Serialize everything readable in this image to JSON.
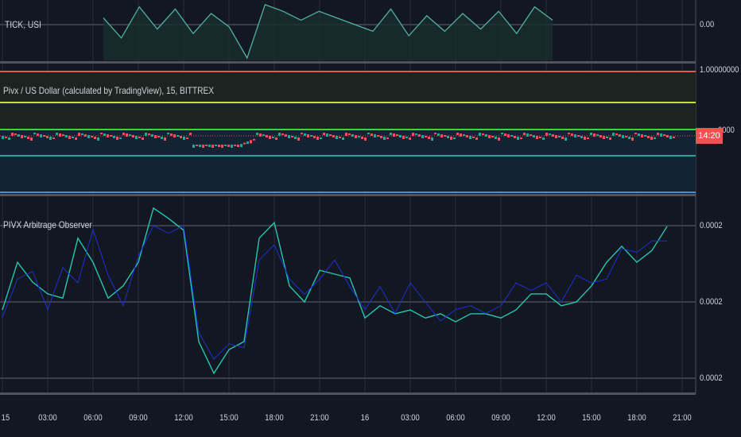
{
  "colors": {
    "background": "#131722",
    "grid": "#2a2e39",
    "cyan": "#26c6b0",
    "blue": "#1e2fd6",
    "red": "#ef5350",
    "yellowgreen": "#c6e03a",
    "green": "#3fd13f",
    "teal": "#26a69a",
    "lightblue": "#3d8fd6"
  },
  "panels": {
    "tick": {
      "title": "TICK, USI",
      "axis_label": "0.00"
    },
    "price": {
      "title": "Pivx / US Dollar (calculated by TradingView), 15, BITTREX",
      "axis_top": "1.00000000",
      "axis_mid": "0000",
      "badge": "14:20"
    },
    "observer": {
      "title": "PIVX Arbitrage Observer",
      "axis_labels": [
        "0.0002",
        "0.0002",
        "0.0002"
      ]
    }
  },
  "time_axis": [
    "15",
    "03:00",
    "06:00",
    "09:00",
    "12:00",
    "15:00",
    "18:00",
    "21:00",
    "16",
    "03:00",
    "06:00",
    "09:00",
    "12:00",
    "15:00",
    "18:00",
    "21:00"
  ],
  "chart_data": [
    {
      "type": "area",
      "title": "TICK, USI",
      "y_ticks": [
        "0.00"
      ],
      "values": [
        0.3,
        -0.6,
        0.8,
        -0.2,
        0.7,
        -0.4,
        0.5,
        -0.1,
        -1.5,
        0.9,
        0.6,
        0.2,
        0.6,
        0.3,
        0.0,
        -0.3,
        0.7,
        -0.5,
        0.4,
        -0.3,
        0.5,
        -0.2,
        0.6,
        -0.4,
        0.8,
        0.2
      ]
    },
    {
      "type": "line",
      "title": "PIVX Arbitrage Observer",
      "y_ticks": [
        "0.0002",
        "0.0002",
        "0.0002"
      ],
      "x": [
        "15 00:00",
        "15 01:00",
        "15 02:00",
        "15 03:00",
        "15 04:00",
        "15 05:00",
        "15 06:00",
        "15 07:00",
        "15 08:00",
        "15 09:00",
        "15 10:00",
        "15 11:00",
        "15 12:00",
        "15 13:00",
        "15 14:00",
        "15 15:00",
        "15 16:00",
        "15 17:00",
        "15 18:00",
        "15 19:00",
        "15 20:00",
        "15 21:00",
        "15 22:00",
        "15 23:00",
        "16 00:00",
        "16 01:00",
        "16 02:00",
        "16 03:00",
        "16 04:00",
        "16 05:00",
        "16 06:00",
        "16 07:00",
        "16 08:00",
        "16 09:00",
        "16 10:00",
        "16 11:00",
        "16 12:00",
        "16 13:00",
        "16 14:00",
        "16 15:00",
        "16 16:00",
        "16 17:00",
        "16 18:00",
        "16 19:00",
        "16 20:00"
      ],
      "series": [
        {
          "color": "#26c6b0",
          "values": [
            0.0002179,
            0.0002304,
            0.0002252,
            0.0002221,
            0.000221,
            0.0002367,
            0.0002304,
            0.000221,
            0.0002242,
            0.0002304,
            0.0002446,
            0.0002419,
            0.0002388,
            0.0002096,
            0.0002013,
            0.0002075,
            0.0002096,
            0.0002367,
            0.0002408,
            0.0002242,
            0.00022,
            0.0002283,
            0.0002273,
            0.0002263,
            0.0002158,
            0.000219,
            0.0002169,
            0.0002179,
            0.0002158,
            0.0002169,
            0.0002148,
            0.0002169,
            0.0002169,
            0.0002158,
            0.0002179,
            0.0002221,
            0.0002221,
            0.000219,
            0.00022,
            0.0002242,
            0.0002304,
            0.0002346,
            0.0002304,
            0.0002335,
            0.0002398
          ]
        },
        {
          "color": "#1e2fd6",
          "values": [
            0.000216,
            0.000226,
            0.000228,
            0.000218,
            0.000229,
            0.000225,
            0.000239,
            0.000227,
            0.000219,
            0.000232,
            0.00024,
            0.000238,
            0.00024,
            0.000212,
            0.000205,
            0.000209,
            0.000208,
            0.000231,
            0.000235,
            0.000226,
            0.000222,
            0.000226,
            0.000231,
            0.000224,
            0.000218,
            0.000224,
            0.000217,
            0.000225,
            0.00022,
            0.000215,
            0.000218,
            0.000219,
            0.000217,
            0.000219,
            0.000225,
            0.000223,
            0.000225,
            0.00022,
            0.000227,
            0.000225,
            0.000226,
            0.000234,
            0.000233,
            0.000236,
            0.000236
          ]
        }
      ]
    }
  ]
}
